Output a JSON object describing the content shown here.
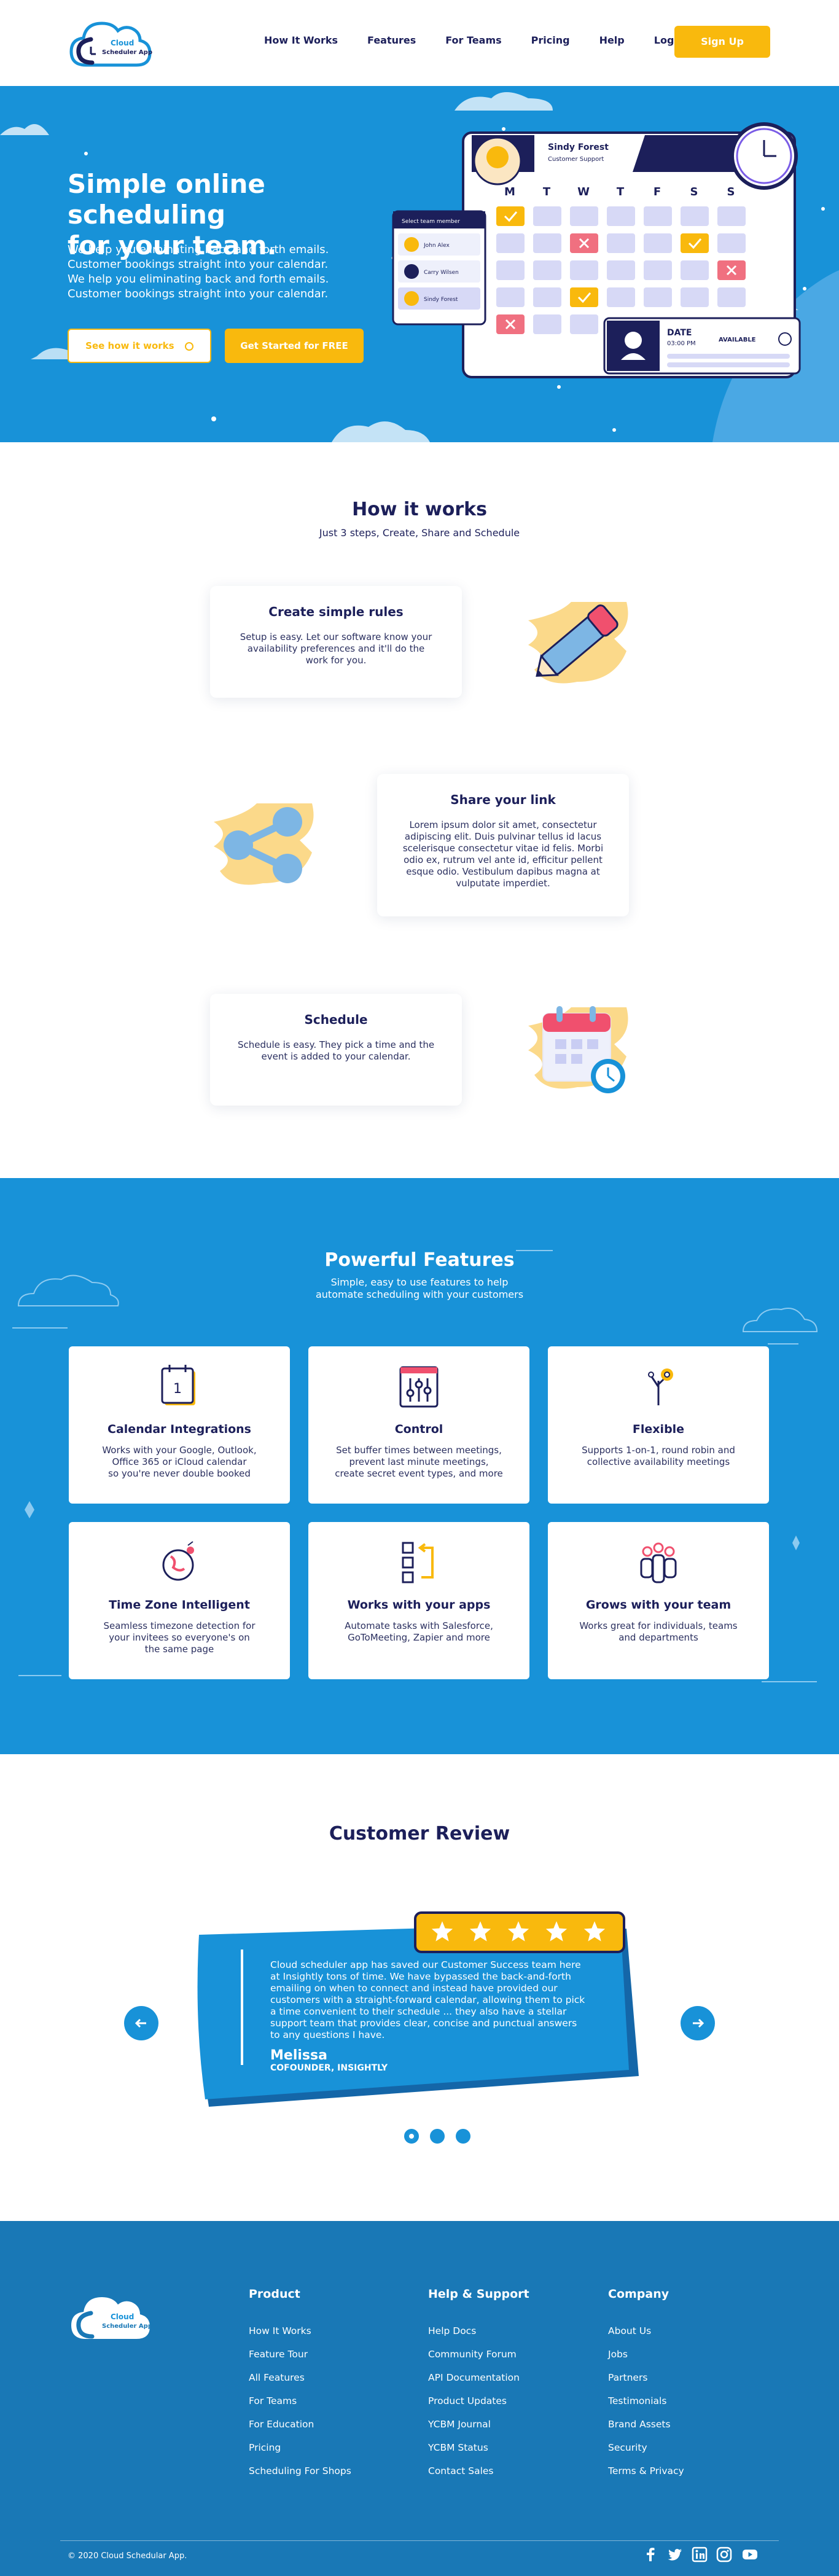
{
  "header": {
    "logo_text_1": "Cloud",
    "logo_text_2": "Scheduler App",
    "nav": [
      "How It Works",
      "Features",
      "For Teams",
      "Pricing",
      "Help",
      "Login"
    ],
    "signup_label": "Sign Up"
  },
  "hero": {
    "title_line1": "Simple online scheduling",
    "title_line2": "for your team.",
    "lead": [
      "We help you eliminating back and forth emails.",
      "Customer bookings straight into your calendar.",
      "We help you eliminating back and forth emails.",
      "Customer bookings straight into your calendar."
    ],
    "btn_secondary": "See how it works",
    "btn_primary": "Get Started for FREE",
    "illustration": {
      "profile_name": "Sindy Forest",
      "profile_role": "Customer Support",
      "days": [
        "M",
        "T",
        "W",
        "T",
        "F",
        "S",
        "S"
      ],
      "member_title": "Select team member",
      "members": [
        "John Alex",
        "Carry Wilsen",
        "Sindy Forest"
      ],
      "date_label": "DATE",
      "time_label": "03:00 PM",
      "available_label": "AVAILABLE"
    }
  },
  "how": {
    "title": "How it works",
    "subtitle": "Just 3 steps, Create, Share and Schedule",
    "steps": [
      {
        "title": "Create simple rules",
        "text": [
          "Setup is easy. Let our software know your",
          "availability preferences and it'll do the",
          "work for you."
        ]
      },
      {
        "title": "Share your link",
        "text": [
          "Lorem ipsum dolor sit amet, consectetur",
          "adipiscing elit. Duis pulvinar tellus id lacus",
          "scelerisque consectetur vitae id felis. Morbi",
          "odio ex, rutrum vel ante id, efficitur pellent",
          "esque odio. Vestibulum dapibus magna at",
          "vulputate imperdiet."
        ]
      },
      {
        "title": "Schedule",
        "text": [
          "Schedule is easy. They pick a time and the",
          "event is added to your calendar."
        ]
      }
    ]
  },
  "features": {
    "title": "Powerful Features",
    "subtitle_1": "Simple, easy to use features to help",
    "subtitle_2": "automate scheduling with your customers",
    "items": [
      {
        "icon": "calendar-icon",
        "title": "Calendar Integrations",
        "text": [
          "Works with your Google, Outlook,",
          "Office 365 or iCloud calendar",
          "so you're never double booked"
        ]
      },
      {
        "icon": "sliders-icon",
        "title": "Control",
        "text": [
          "Set buffer times between meetings,",
          "prevent last minute meetings,",
          "create secret event types, and more"
        ]
      },
      {
        "icon": "flexible-icon",
        "title": "Flexible",
        "text": [
          "Supports 1-on-1, round robin and",
          "collective availability meetings"
        ]
      },
      {
        "icon": "globe-icon",
        "title": "Time Zone Intelligent",
        "text": [
          "Seamless timezone detection for",
          "your invitees so everyone's on",
          "the same page"
        ]
      },
      {
        "icon": "apps-icon",
        "title": "Works with your apps",
        "text": [
          "Automate tasks with Salesforce,",
          "GoToMeeting, Zapier and more"
        ]
      },
      {
        "icon": "team-icon",
        "title": "Grows with your team",
        "text": [
          "Works great for individuals, teams",
          "and departments"
        ]
      }
    ]
  },
  "review": {
    "title": "Customer Review",
    "text": [
      "Cloud scheduler app has saved our Customer Success team here",
      "at Insightly tons of time. We have bypassed the back-and-forth",
      "emailing on when to connect and instead have provided our",
      "customers with a straight-forward calendar, allowing them to pick",
      "a time convenient to their schedule ... they also have a stellar",
      "support team that provides clear, concise and punctual answers",
      "to any questions I have."
    ],
    "author": "Melissa",
    "role": "COFOUNDER, INSIGHTLY",
    "rating": 5,
    "prev_icon": "arrow-left-icon",
    "next_icon": "arrow-right-icon"
  },
  "footer": {
    "logo_text_1": "Cloud",
    "logo_text_2": "Scheduler App",
    "columns": [
      {
        "title": "Product",
        "links": [
          "How It Works",
          "Feature Tour",
          "All Features",
          "For Teams",
          "For Education",
          "Pricing",
          "Scheduling For Shops"
        ]
      },
      {
        "title": "Help & Support",
        "links": [
          "Help Docs",
          "Community Forum",
          "API Documentation",
          "Product Updates",
          "YCBM Journal",
          "YCBM Status",
          "Contact Sales"
        ]
      },
      {
        "title": "Company",
        "links": [
          "About Us",
          "Jobs",
          "Partners",
          "Testimonials",
          "Brand Assets",
          "Security",
          "Terms & Privacy"
        ]
      }
    ],
    "copyright": "© 2020 Cloud Schedular App.",
    "social": [
      "facebook-icon",
      "twitter-icon",
      "linkedin-icon",
      "instagram-icon",
      "youtube-icon"
    ]
  },
  "colors": {
    "primary_blue": "#1892d8",
    "navy": "#1c1f5a",
    "accent_yellow": "#f9b90d",
    "footer_blue": "#1978b6"
  }
}
